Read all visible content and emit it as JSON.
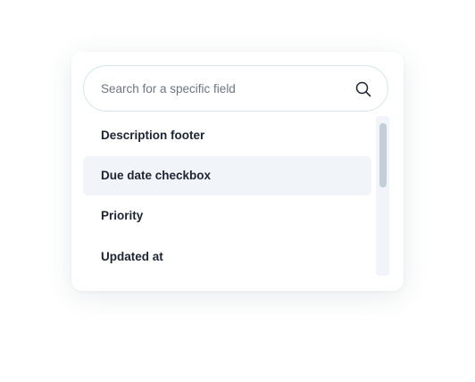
{
  "search": {
    "placeholder": "Search for a specific field",
    "value": "",
    "icon": "search-icon"
  },
  "fields": {
    "items": [
      {
        "label": "Description footer",
        "selected": false
      },
      {
        "label": "Due date checkbox",
        "selected": true
      },
      {
        "label": "Priority",
        "selected": false
      },
      {
        "label": "Updated at",
        "selected": false
      }
    ]
  },
  "colors": {
    "highlight": "#f1f4f8",
    "search_border": "#d7e6e9",
    "text": "#1c2431",
    "placeholder": "#6d7580",
    "scrollbar_thumb": "#c4ced9"
  }
}
